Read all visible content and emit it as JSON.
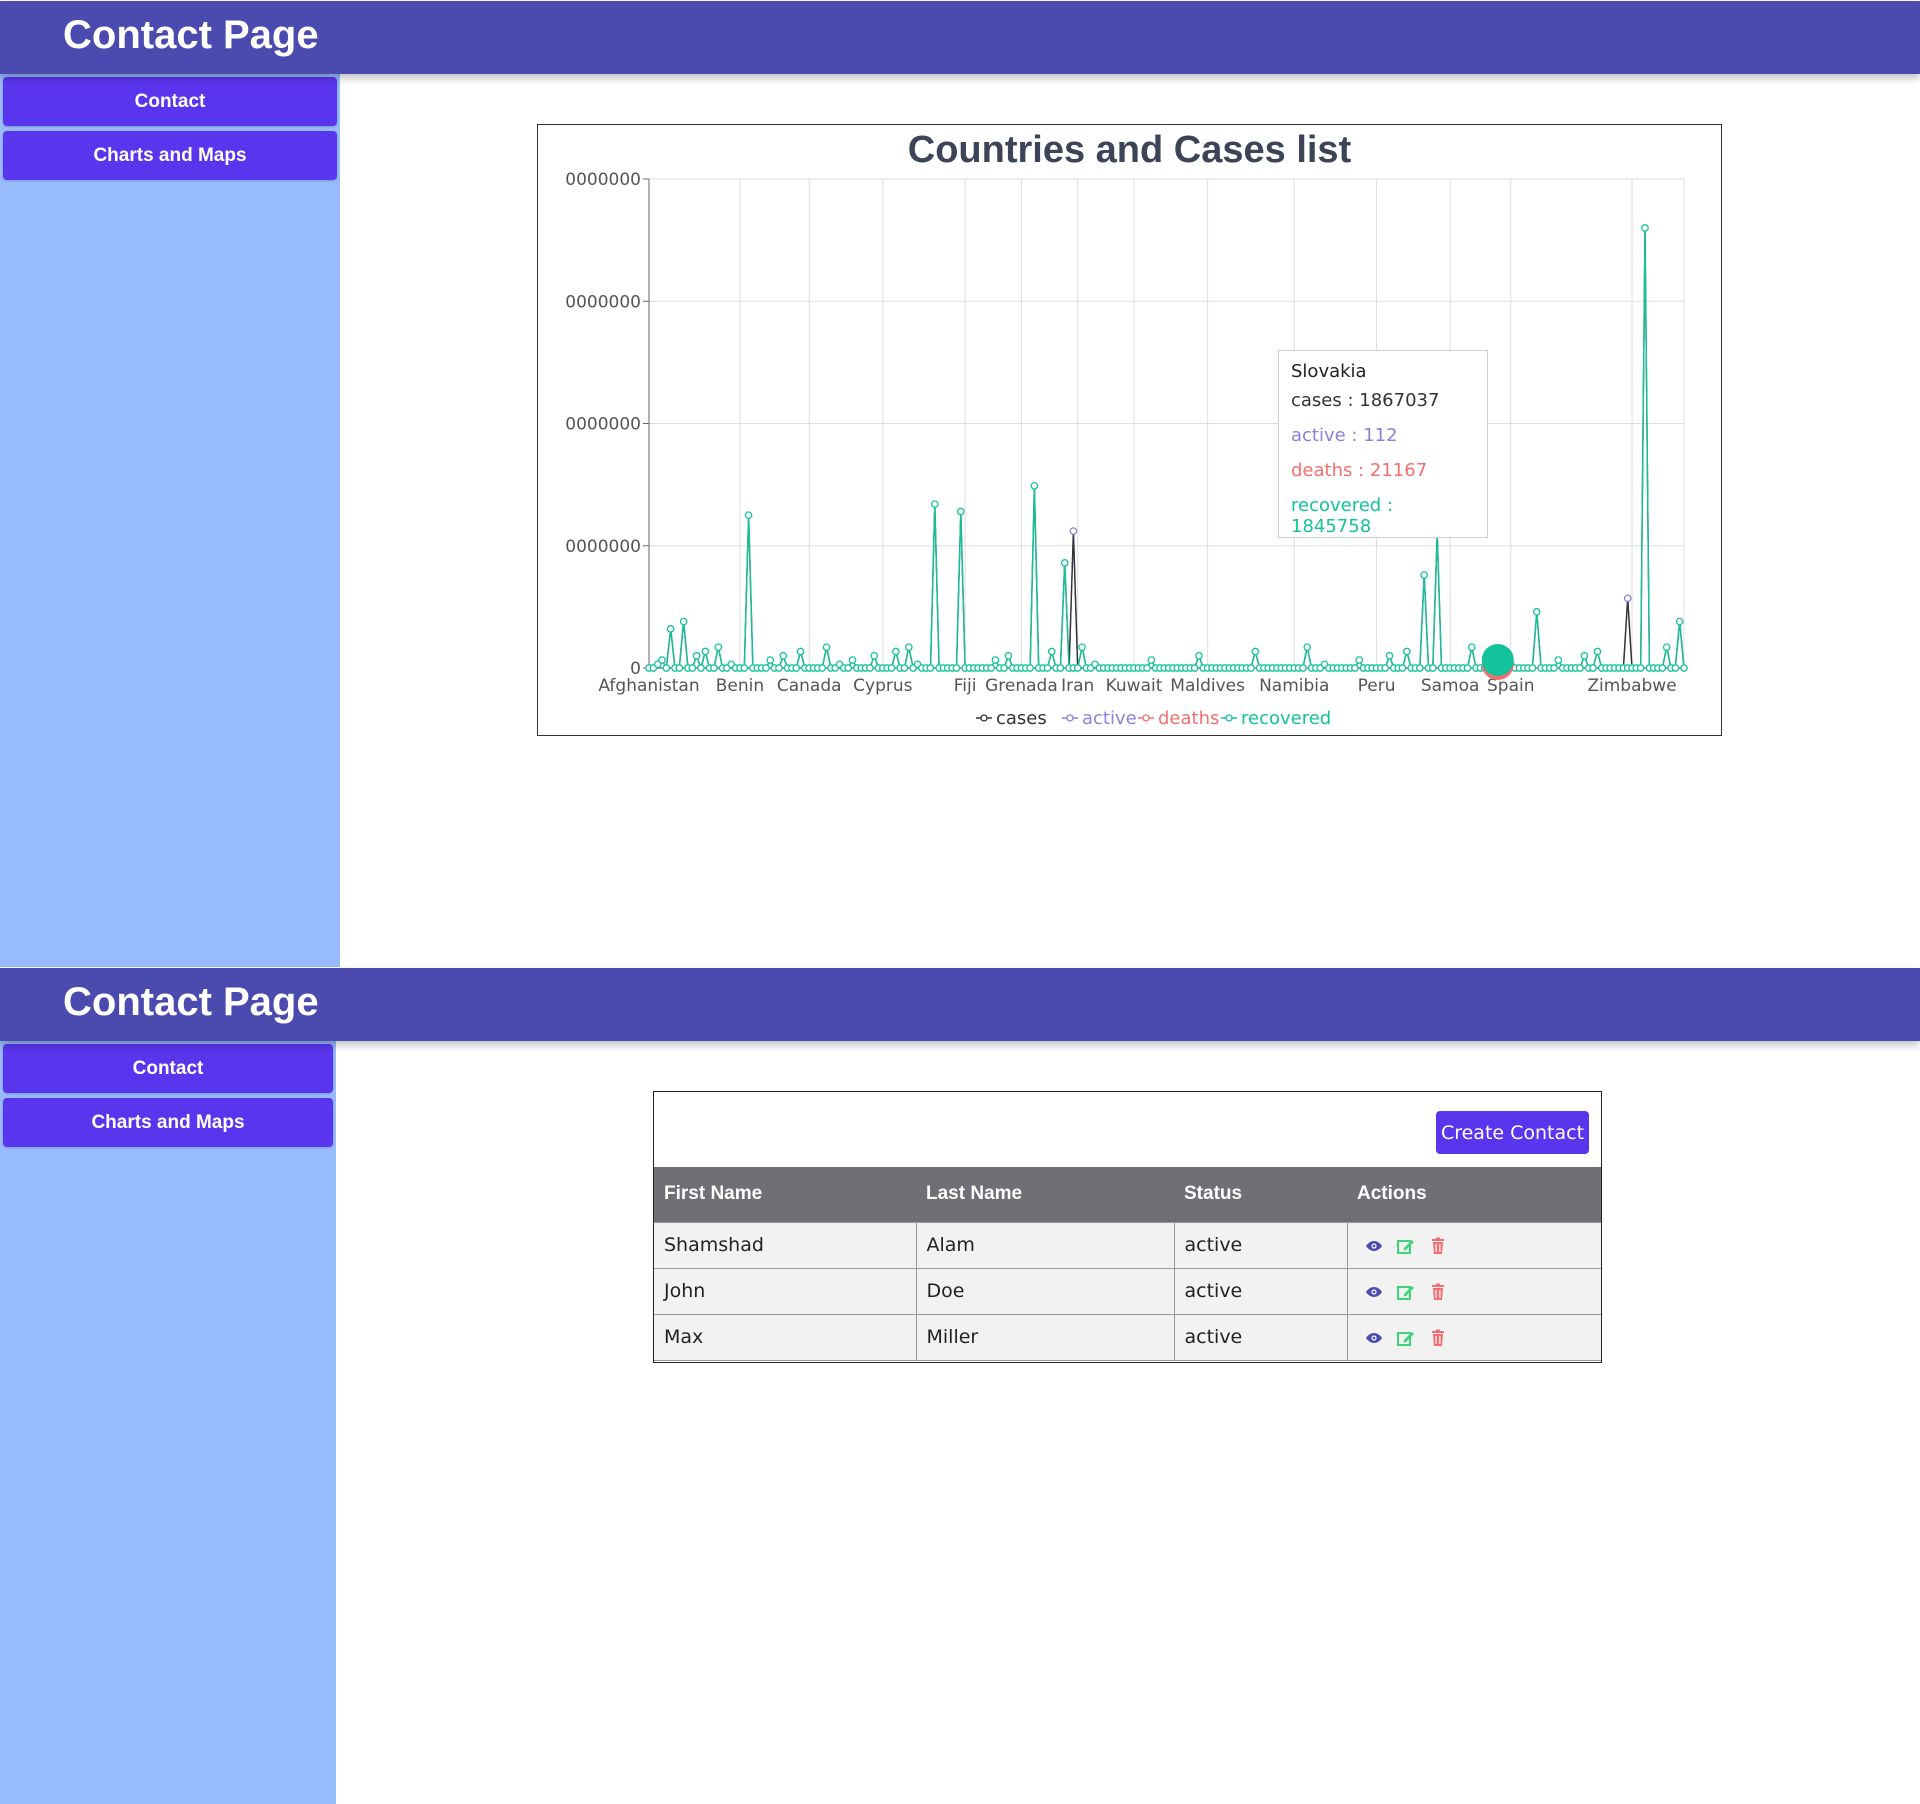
{
  "header": {
    "title": "Contact Page"
  },
  "sidebar": {
    "items": [
      {
        "label": "Contact"
      },
      {
        "label": "Charts and Maps"
      }
    ]
  },
  "chart": {
    "tooltip": {
      "country": "Slovakia",
      "cases": "cases : 1867037",
      "active": "active : 112",
      "deaths": "deaths : 21167",
      "recovered": "recovered : 1845758"
    }
  },
  "chart_data": {
    "type": "line",
    "title": "Countries and Cases list",
    "xlabel": "",
    "ylabel": "",
    "y_tick_labels": [
      "0",
      "0000000",
      "0000000",
      "0000000",
      "0000000"
    ],
    "x_tick_labels": [
      "Afghanistan",
      "Benin",
      "Canada",
      "Cyprus",
      "Fiji",
      "Grenada",
      "Iran",
      "Kuwait",
      "Maldives",
      "Namibia",
      "Peru",
      "Samoa",
      "Spain",
      "Zimbabwe"
    ],
    "ylim": [
      0,
      40000000
    ],
    "grid": true,
    "legend_position": "bottom-center",
    "colors": {
      "cases": "#333333",
      "active": "#8884d8",
      "deaths": "#f36f6f",
      "recovered": "#14c39b"
    },
    "series": [
      {
        "name": "cases"
      },
      {
        "name": "active"
      },
      {
        "name": "deaths"
      },
      {
        "name": "recovered"
      }
    ],
    "notable_points": [
      {
        "series": "recovered",
        "x_index": 5,
        "value": 3200000
      },
      {
        "series": "recovered",
        "x_index": 8,
        "value": 3800000
      },
      {
        "series": "recovered",
        "x_index": 23,
        "value": 12500000
      },
      {
        "series": "recovered",
        "x_index": 66,
        "value": 13400000
      },
      {
        "series": "recovered",
        "x_index": 72,
        "value": 12800000
      },
      {
        "series": "recovered",
        "x_index": 89,
        "value": 14900000
      },
      {
        "series": "recovered",
        "x_index": 96,
        "value": 8600000
      },
      {
        "series": "active",
        "x_index": 98,
        "value": 11200000
      },
      {
        "series": "recovered",
        "x_index": 179,
        "value": 7600000
      },
      {
        "series": "recovered",
        "x_index": 182,
        "value": 11000000
      },
      {
        "series": "recovered",
        "x_index": 205,
        "value": 4600000
      },
      {
        "series": "active",
        "x_index": 226,
        "value": 5700000
      },
      {
        "series": "recovered",
        "x_index": 230,
        "value": 36000000
      },
      {
        "series": "recovered",
        "x_index": 238,
        "value": 3800000
      }
    ]
  },
  "contacts": {
    "create_label": "Create Contact",
    "columns": [
      "First Name",
      "Last Name",
      "Status",
      "Actions"
    ],
    "rows": [
      {
        "first": "Shamshad",
        "last": "Alam",
        "status": "active"
      },
      {
        "first": "John",
        "last": "Doe",
        "status": "active"
      },
      {
        "first": "Max",
        "last": "Miller",
        "status": "active"
      }
    ],
    "action_icons": [
      "view-icon",
      "edit-icon",
      "delete-icon"
    ],
    "action_colors": {
      "view": "#4b4aae",
      "edit": "#3ed47a",
      "delete": "#f36f6f"
    }
  }
}
